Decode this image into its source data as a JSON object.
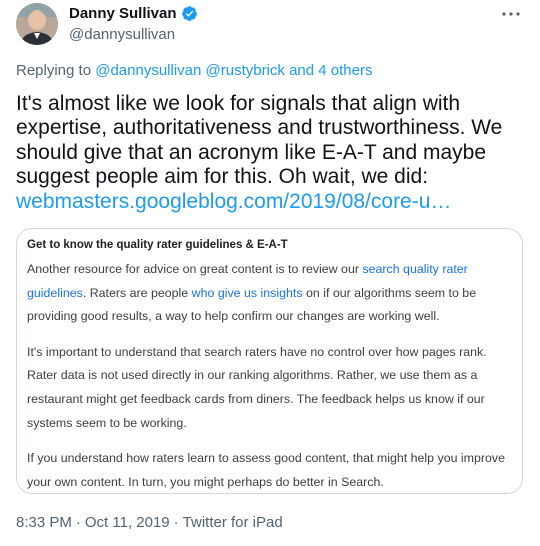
{
  "author": {
    "name": "Danny Sullivan",
    "handle": "@dannysullivan",
    "verified": true
  },
  "replying": {
    "prefix": "Replying to ",
    "mention1": "@dannysullivan",
    "mention2": "@rustybrick",
    "and_others": "and 4 others"
  },
  "tweet": {
    "text": "It's almost like we look for signals that align with expertise, authoritativeness and trustworthiness. We should give that an acronym like E-A-T and maybe suggest people aim for this. Oh wait, we did: ",
    "link": "webmasters.googleblog.com/2019/08/core-u…"
  },
  "card": {
    "heading": "Get to know the quality rater guidelines & E-A-T",
    "p1_a": "Another resource for advice on great content is to review our ",
    "p1_link1": "search quality rater guidelines",
    "p1_b": ". Raters are people ",
    "p1_link2": "who give us insights",
    "p1_c": " on if our algorithms seem to be providing good results, a way to help confirm our changes are working well.",
    "p2": "It's important to understand that search raters have no control over how pages rank. Rater data is not used directly in our ranking algorithms. Rather, we use them as a restaurant might get feedback cards from diners. The feedback helps us know if our systems seem to be working.",
    "p3": "If you understand how raters learn to assess good content, that might help you improve your own content. In turn, you might perhaps do better in Search."
  },
  "meta": {
    "time": "8:33 PM",
    "separator": "·",
    "date": "Oct 11, 2019",
    "source": "Twitter for iPad"
  },
  "colors": {
    "accent": "#1d9bf0",
    "secondary_text": "#536471",
    "border": "#cfd9de"
  },
  "icons": {
    "verified": "verified-badge-icon",
    "more": "more-horizontal-icon"
  }
}
